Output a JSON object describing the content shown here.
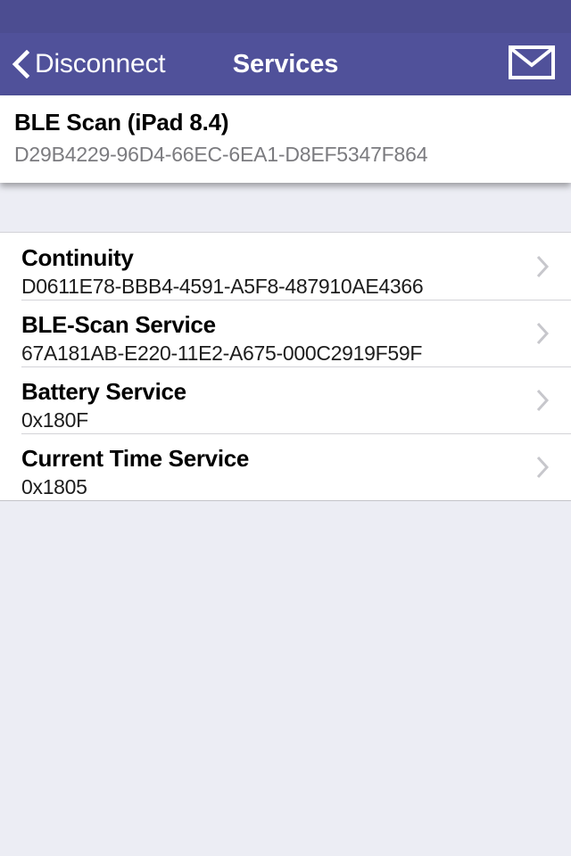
{
  "status_bar": {
    "background": "#4c4d91"
  },
  "nav_bar": {
    "background": "#50519a",
    "back_label": "Disconnect",
    "back_icon": "chevron-left-icon",
    "title": "Services",
    "action_icon": "mail-envelope-icon"
  },
  "device_header": {
    "name": "BLE Scan (iPad 8.4)",
    "uuid": "D29B4229-96D4-66EC-6EA1-D8EF5347F864"
  },
  "services": [
    {
      "name": "Continuity",
      "uuid": "D0611E78-BBB4-4591-A5F8-487910AE4366",
      "disclosure_icon": "chevron-right-icon"
    },
    {
      "name": "BLE-Scan Service",
      "uuid": "67A181AB-E220-11E2-A675-000C2919F59F",
      "disclosure_icon": "chevron-right-icon"
    },
    {
      "name": "Battery Service",
      "uuid": "0x180F",
      "disclosure_icon": "chevron-right-icon"
    },
    {
      "name": "Current Time Service",
      "uuid": "0x1805",
      "disclosure_icon": "chevron-right-icon"
    }
  ],
  "colors": {
    "nav_background": "#50519a",
    "status_background": "#4c4d91",
    "page_background": "#ecedf4",
    "card_background": "#ffffff",
    "separator": "#d3d3d8",
    "chevron": "#c7c7cc",
    "subtitle_grey": "#7b7b7f"
  }
}
